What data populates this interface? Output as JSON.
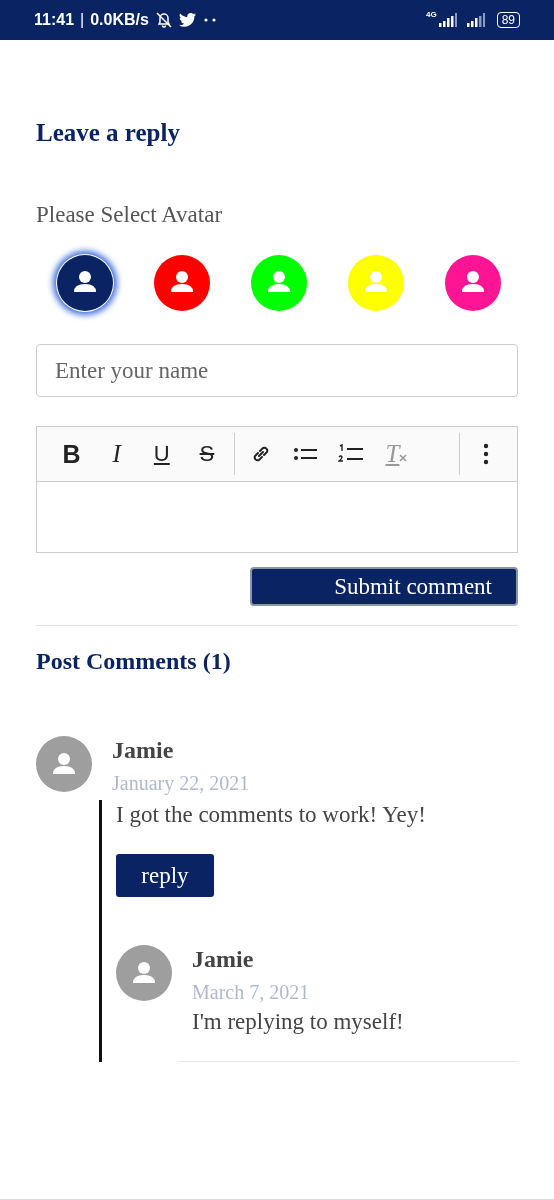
{
  "status_bar": {
    "time": "11:41",
    "separator": "|",
    "speed": "0.0KB/s",
    "network": "4G",
    "battery": "89"
  },
  "reply_form": {
    "title": "Leave a reply",
    "avatar_prompt": "Please Select Avatar",
    "avatars": [
      {
        "color": "#0a2463",
        "selected": true
      },
      {
        "color": "#ff0000",
        "selected": false
      },
      {
        "color": "#00ff00",
        "selected": false
      },
      {
        "color": "#ffff00",
        "selected": false
      },
      {
        "color": "#ff1493",
        "selected": false
      }
    ],
    "name_field": {
      "placeholder": "Enter your name"
    },
    "toolbar": [
      {
        "kind": "bold",
        "label": "B"
      },
      {
        "kind": "italic",
        "label": "I"
      },
      {
        "kind": "underline",
        "label": "U"
      },
      {
        "kind": "strike",
        "label": "S"
      },
      {
        "kind": "divider"
      },
      {
        "kind": "link"
      },
      {
        "kind": "bullet"
      },
      {
        "kind": "ordered"
      },
      {
        "kind": "clean",
        "label": "T"
      },
      {
        "kind": "divider"
      },
      {
        "kind": "more"
      }
    ],
    "submit": "Submit comment"
  },
  "comments": {
    "title": "Post Comments (1)",
    "items": [
      {
        "author": "Jamie",
        "date": "January 22, 2021",
        "text": "I got the comments to work! Yey!",
        "reply_button": "reply",
        "children": [
          {
            "author": "Jamie",
            "date": "March 7, 2021",
            "text": "I'm replying to myself!"
          }
        ]
      }
    ]
  }
}
